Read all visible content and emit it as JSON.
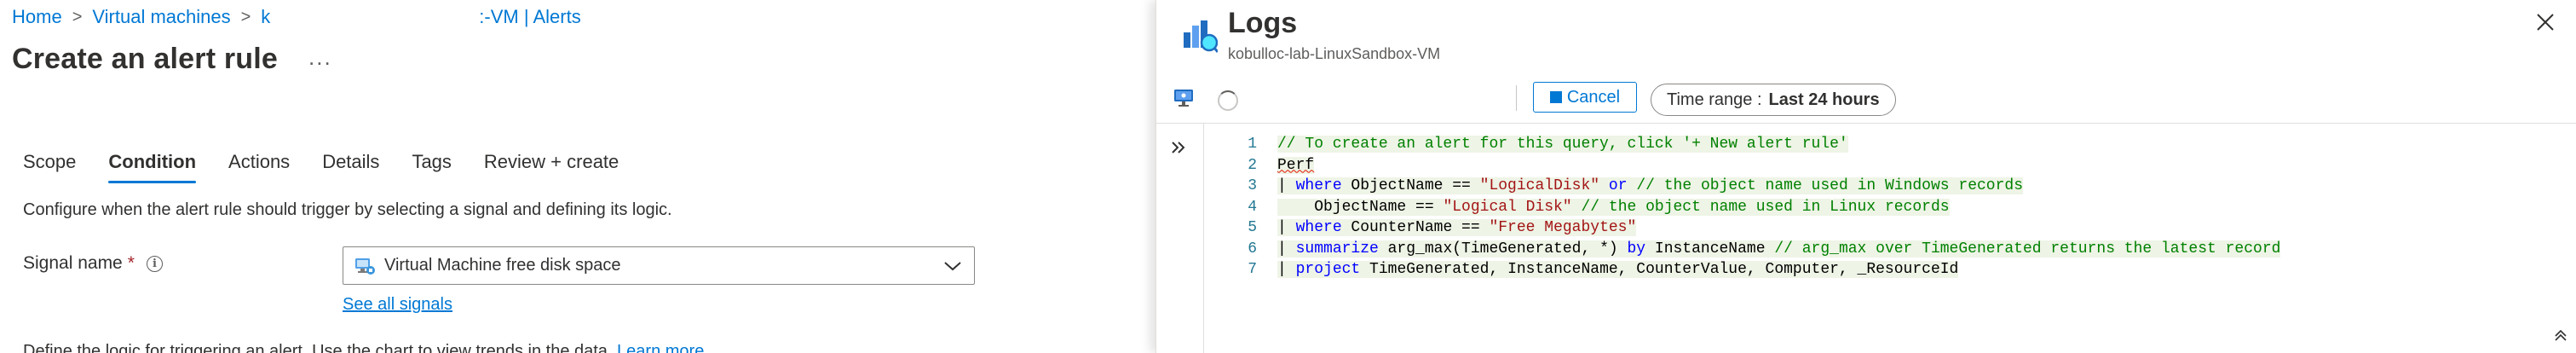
{
  "breadcrumb": {
    "items": [
      "Home",
      "Virtual machines",
      "k"
    ],
    "tail": ":-VM | Alerts"
  },
  "page": {
    "title": "Create an alert rule",
    "more": "..."
  },
  "tabs": [
    {
      "label": "Scope"
    },
    {
      "label": "Condition",
      "active": true
    },
    {
      "label": "Actions"
    },
    {
      "label": "Details"
    },
    {
      "label": "Tags"
    },
    {
      "label": "Review + create"
    }
  ],
  "condition": {
    "description": "Configure when the alert rule should trigger by selecting a signal and defining its logic.",
    "signal_label": "Signal name",
    "required_mark": "*",
    "signal_value": "Virtual Machine free disk space",
    "see_all": "See all signals",
    "bottom_text": "Define the logic for triggering an alert. Use the chart to view trends in the data.",
    "learn_more": "Learn more"
  },
  "logs": {
    "title": "Logs",
    "subtitle": "kobulloc-lab-LinuxSandbox-VM",
    "cancel_label": "Cancel",
    "time_range_label": "Time range :",
    "time_range_value": "Last 24 hours"
  },
  "code_lines": [
    {
      "n": "1",
      "tokens": [
        {
          "t": "// To create an alert for this query, click '+ New alert rule'",
          "c": "comment"
        }
      ]
    },
    {
      "n": "2",
      "tokens": [
        {
          "t": "Perf",
          "c": "plain-squiggle"
        }
      ]
    },
    {
      "n": "3",
      "tokens": [
        {
          "t": "| ",
          "c": "plain"
        },
        {
          "t": "where",
          "c": "kw"
        },
        {
          "t": " ObjectName == ",
          "c": "plain"
        },
        {
          "t": "\"LogicalDisk\"",
          "c": "str"
        },
        {
          "t": " ",
          "c": "plain"
        },
        {
          "t": "or",
          "c": "kw"
        },
        {
          "t": " ",
          "c": "plain"
        },
        {
          "t": "// the object name used in Windows records",
          "c": "comment"
        }
      ]
    },
    {
      "n": "4",
      "tokens": [
        {
          "t": "    ObjectName == ",
          "c": "plain"
        },
        {
          "t": "\"Logical Disk\"",
          "c": "str"
        },
        {
          "t": " ",
          "c": "plain"
        },
        {
          "t": "// the object name used in Linux records",
          "c": "comment"
        }
      ]
    },
    {
      "n": "5",
      "tokens": [
        {
          "t": "| ",
          "c": "plain"
        },
        {
          "t": "where",
          "c": "kw"
        },
        {
          "t": " CounterName == ",
          "c": "plain"
        },
        {
          "t": "\"Free Megabytes\"",
          "c": "str"
        }
      ]
    },
    {
      "n": "6",
      "tokens": [
        {
          "t": "| ",
          "c": "plain"
        },
        {
          "t": "summarize",
          "c": "kw"
        },
        {
          "t": " arg_max(TimeGenerated, *) ",
          "c": "plain"
        },
        {
          "t": "by",
          "c": "kw"
        },
        {
          "t": " InstanceName ",
          "c": "plain"
        },
        {
          "t": "// arg_max over TimeGenerated returns the latest record",
          "c": "comment"
        }
      ]
    },
    {
      "n": "7",
      "tokens": [
        {
          "t": "| ",
          "c": "plain"
        },
        {
          "t": "project",
          "c": "kw"
        },
        {
          "t": " TimeGenerated, InstanceName, CounterValue, Computer, _ResourceId",
          "c": "plain"
        }
      ]
    }
  ],
  "icons": {
    "logs": "logs-chart-icon",
    "vm": "virtual-machine-icon",
    "monitor": "monitor-icon",
    "close": "close-icon",
    "expand": "chevron-double-right-icon"
  },
  "colors": {
    "accent": "#0078d4",
    "keyword": "#0000ff",
    "comment": "#008000",
    "string": "#a31515"
  }
}
